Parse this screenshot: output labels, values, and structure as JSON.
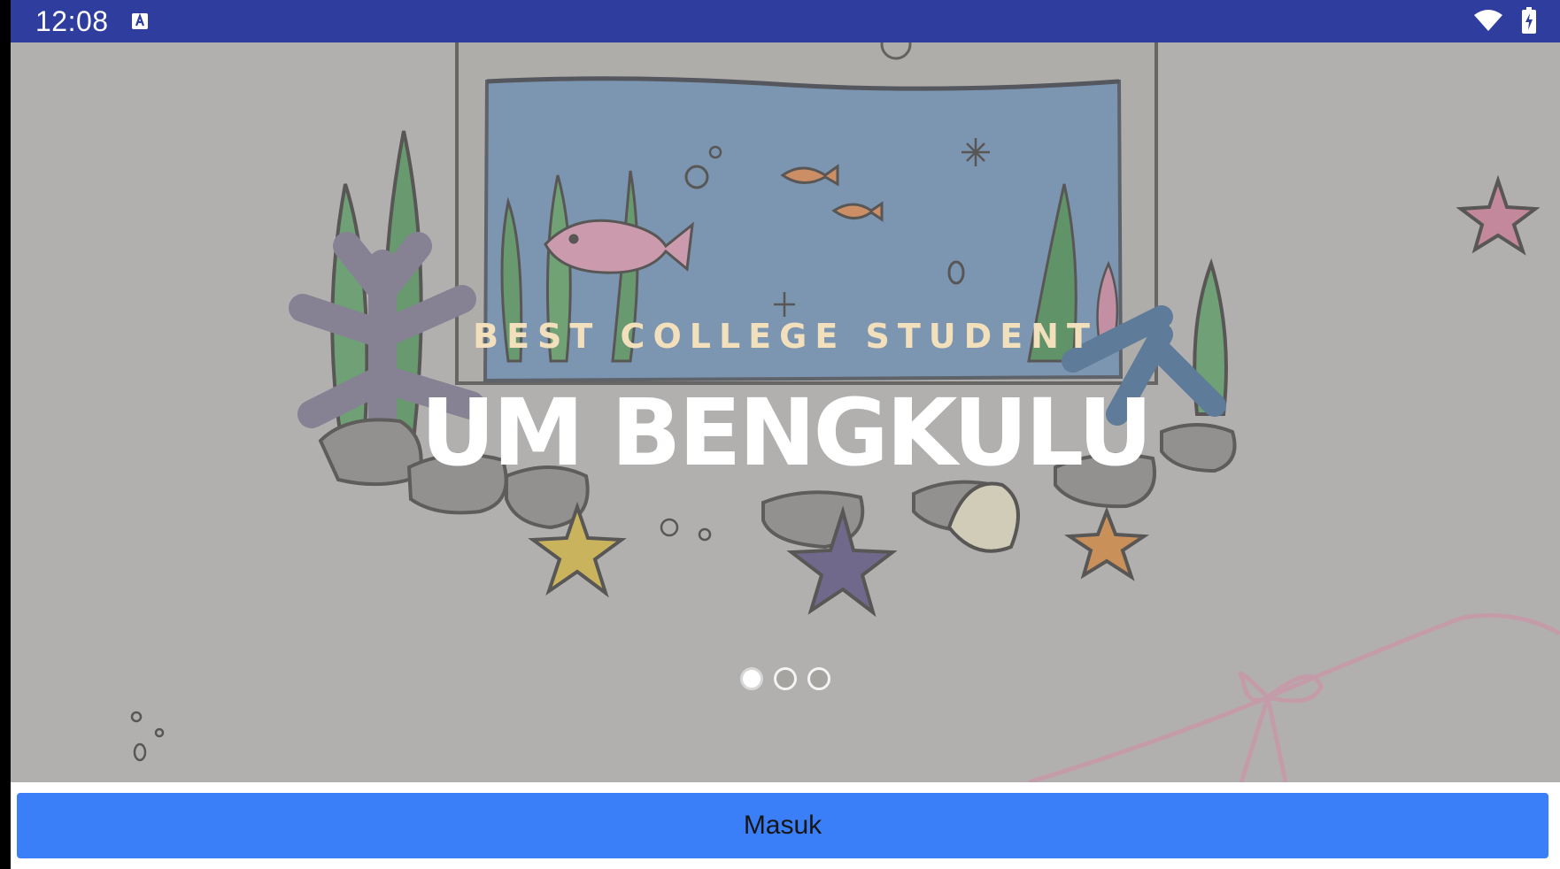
{
  "status_bar": {
    "time": "12:08",
    "icons": [
      "keyboard-notification-icon",
      "wifi-icon",
      "battery-charging-icon"
    ]
  },
  "hero": {
    "subtitle": "BEST COLLEGE STUDENT",
    "title": "UM BENGKULU",
    "carousel": {
      "page_count": 3,
      "active_index": 0
    }
  },
  "actions": {
    "login_label": "Masuk"
  },
  "colors": {
    "status_bar": "#2f3d9e",
    "button": "#3a7ef8",
    "subtitle": "#f1e0bb",
    "overlay_bg": "#bdbbb8"
  }
}
